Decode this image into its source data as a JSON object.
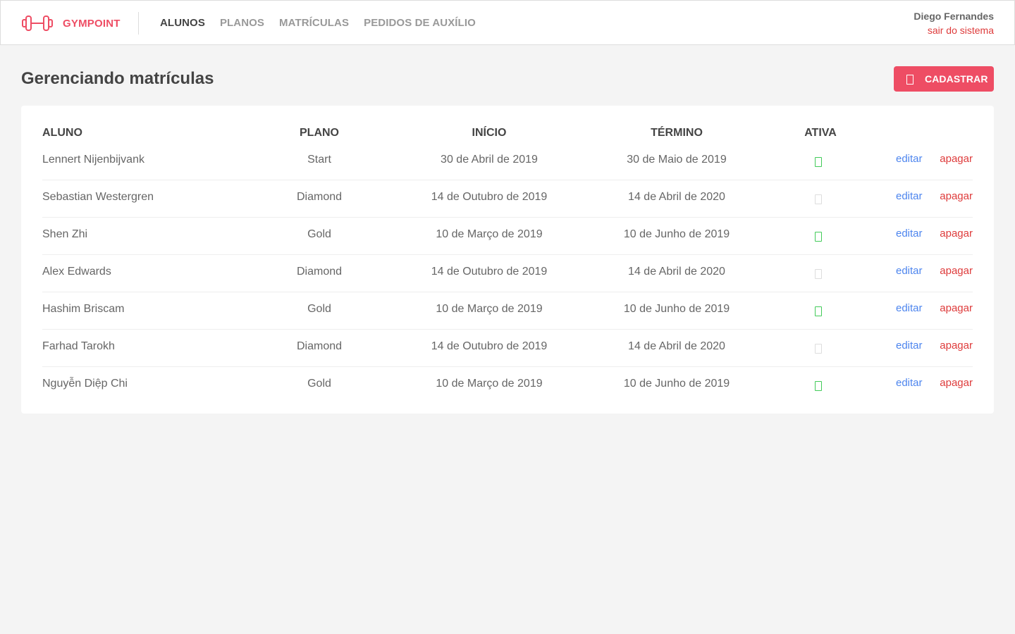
{
  "brand": {
    "name": "GYMPOINT",
    "icon": "dumbbell-icon",
    "color": "#ee4d64"
  },
  "nav": {
    "items": [
      {
        "label": "ALUNOS",
        "active": true
      },
      {
        "label": "PLANOS",
        "active": false
      },
      {
        "label": "MATRÍCULAS",
        "active": false
      },
      {
        "label": "PEDIDOS DE AUXÍLIO",
        "active": false
      }
    ]
  },
  "user": {
    "name": "Diego Fernandes",
    "logout_label": "sair do sistema"
  },
  "page": {
    "title": "Gerenciando matrículas",
    "add_button_label": "CADASTRAR",
    "add_button_icon": "add-icon"
  },
  "table": {
    "columns": [
      "ALUNO",
      "PLANO",
      "INÍCIO",
      "TÉRMINO",
      "ATIVA"
    ],
    "edit_label": "editar",
    "delete_label": "apagar",
    "rows": [
      {
        "student": "Lennert Nijenbijvank",
        "plan": "Start",
        "start": "30 de Abril de 2019",
        "end": "30 de Maio de 2019",
        "active": true
      },
      {
        "student": "Sebastian Westergren",
        "plan": "Diamond",
        "start": "14 de Outubro de 2019",
        "end": "14 de Abril de 2020",
        "active": false
      },
      {
        "student": "Shen Zhi",
        "plan": "Gold",
        "start": "10 de Março de 2019",
        "end": "10 de Junho de 2019",
        "active": true
      },
      {
        "student": "Alex Edwards",
        "plan": "Diamond",
        "start": "14 de Outubro de 2019",
        "end": "14 de Abril de 2020",
        "active": false
      },
      {
        "student": "Hashim Briscam",
        "plan": "Gold",
        "start": "10 de Março de 2019",
        "end": "10 de Junho de 2019",
        "active": true
      },
      {
        "student": "Farhad Tarokh",
        "plan": "Diamond",
        "start": "14 de Outubro de 2019",
        "end": "14 de Abril de 2020",
        "active": false
      },
      {
        "student": "Nguyễn Diệp Chi",
        "plan": "Gold",
        "start": "10 de Março de 2019",
        "end": "10 de Junho de 2019",
        "active": true
      }
    ]
  },
  "colors": {
    "accent": "#ee4d64",
    "edit": "#4d85ee",
    "delete": "#de3b3b",
    "active_check": "#42cb59",
    "inactive_check": "#dddddd"
  }
}
